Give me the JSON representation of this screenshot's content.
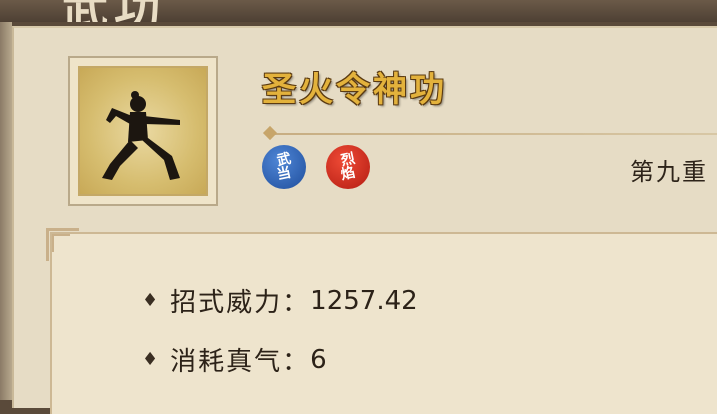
{
  "header": {
    "title": "武功"
  },
  "skill": {
    "name": "圣火令神功",
    "level": "第九重",
    "tags": [
      {
        "line1": "武",
        "line2": "当",
        "color": "#2a5fb8"
      },
      {
        "line1": "烈",
        "line2": "焰",
        "color": "#d2281a"
      }
    ],
    "icon": "martial-artist-icon"
  },
  "stats": [
    {
      "label": "招式威力：",
      "value": "1257.42"
    },
    {
      "label": "消耗真气：",
      "value": "6"
    }
  ],
  "colors": {
    "name_gold": "#e3b23c",
    "panel_bg": "#e6dcc5"
  }
}
